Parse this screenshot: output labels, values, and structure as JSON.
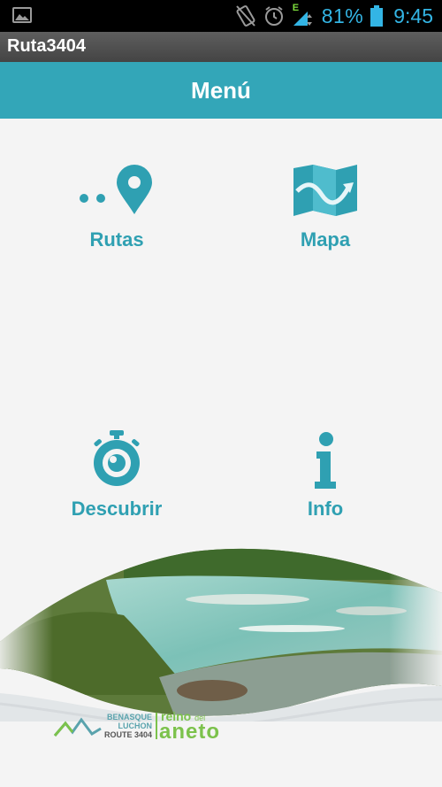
{
  "status_bar": {
    "battery_percent": "81%",
    "time": "9:45",
    "network_label": "E",
    "icons": [
      "gallery-icon",
      "vibrate-icon",
      "alarm-icon",
      "signal-icon",
      "battery-icon"
    ],
    "accent_color": "#33b5e5"
  },
  "app": {
    "title": "Ruta3404"
  },
  "header": {
    "title": "Menú",
    "color": "#33a6b8"
  },
  "menu": {
    "items": [
      {
        "label": "Rutas",
        "icon": "route-pin-icon"
      },
      {
        "label": "Mapa",
        "icon": "map-icon"
      },
      {
        "label": "Descubrir",
        "icon": "stopwatch-eye-icon"
      },
      {
        "label": "Info",
        "icon": "info-icon"
      }
    ],
    "label_color": "#2fa0b2"
  },
  "footer": {
    "logo_line1": "BENASQUE",
    "logo_line2": "LUCHON",
    "logo_line3": "ROUTE 3404",
    "reino_line1": "reino",
    "reino_small": "del",
    "reino_line2": "aneto"
  }
}
